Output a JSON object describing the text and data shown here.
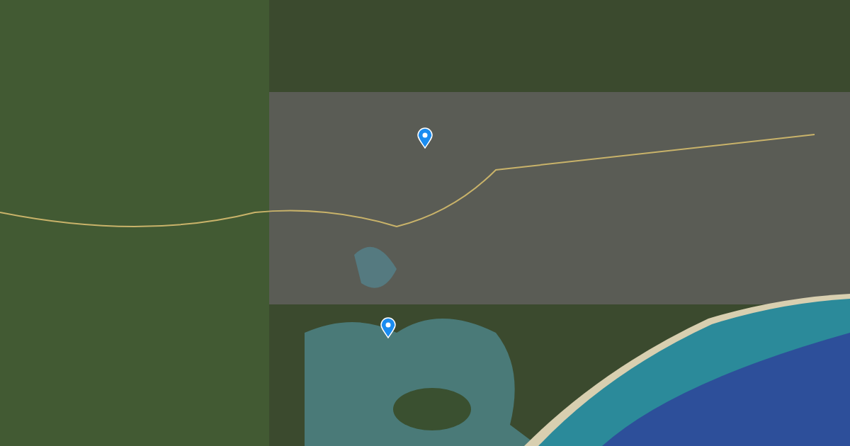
{
  "map": {
    "markers": [
      {
        "kind": "pin"
      },
      {
        "kind": "pin"
      }
    ]
  }
}
